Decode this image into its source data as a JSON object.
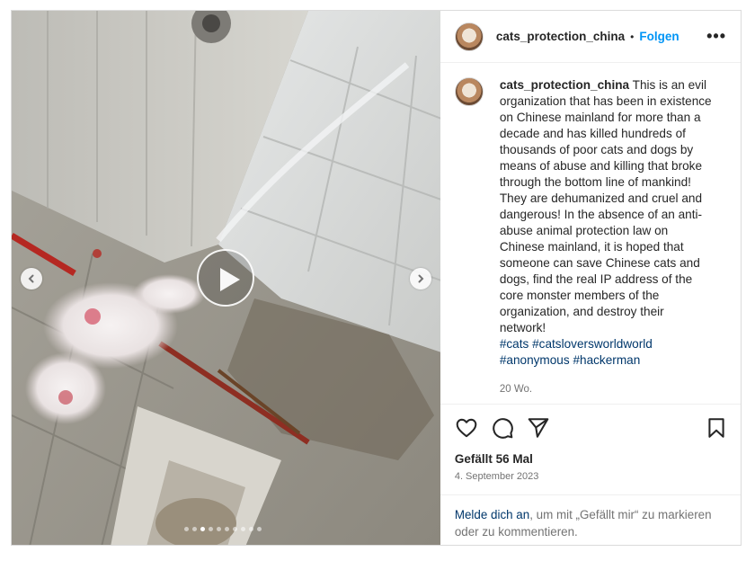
{
  "post": {
    "username": "cats_protection_china",
    "separator": "•",
    "follow_label": "Folgen",
    "more_label": "•••",
    "caption_username": "cats_protection_china",
    "caption_text": "This is an evil organization that has been in existence on Chinese mainland for more than a decade and has killed hundreds of thousands of poor cats and dogs by means of abuse and killing that broke through the bottom line of mankind! They are dehumanized and cruel and dangerous! In the absence of an anti-abuse animal protection law on Chinese mainland, it is hoped that someone can save Chinese cats and dogs, find the real IP address of the core monster members of the organization, and destroy their network!",
    "hashtags_line1": [
      "#cats",
      "#catsloversworldworld"
    ],
    "hashtags_line2": [
      "#anonymous",
      "#hackerman"
    ],
    "relative_time": "20 Wo.",
    "likes": "Gefällt 56 Mal",
    "date": "4. September 2023",
    "login_link": "Melde dich an",
    "login_text": ", um mit „Gefällt mir“ zu markieren oder zu kommentieren."
  },
  "media": {
    "type": "video-carousel",
    "slide_count": 10,
    "active_slide": 3
  },
  "icons": {
    "like": "heart-icon",
    "comment": "comment-icon",
    "share": "paper-plane-icon",
    "save": "bookmark-icon",
    "prev": "chevron-left-icon",
    "next": "chevron-right-icon",
    "play": "play-icon"
  },
  "colors": {
    "link_blue": "#0095f6",
    "hashtag_blue": "#00376b",
    "muted": "#737373",
    "text": "#262626"
  }
}
